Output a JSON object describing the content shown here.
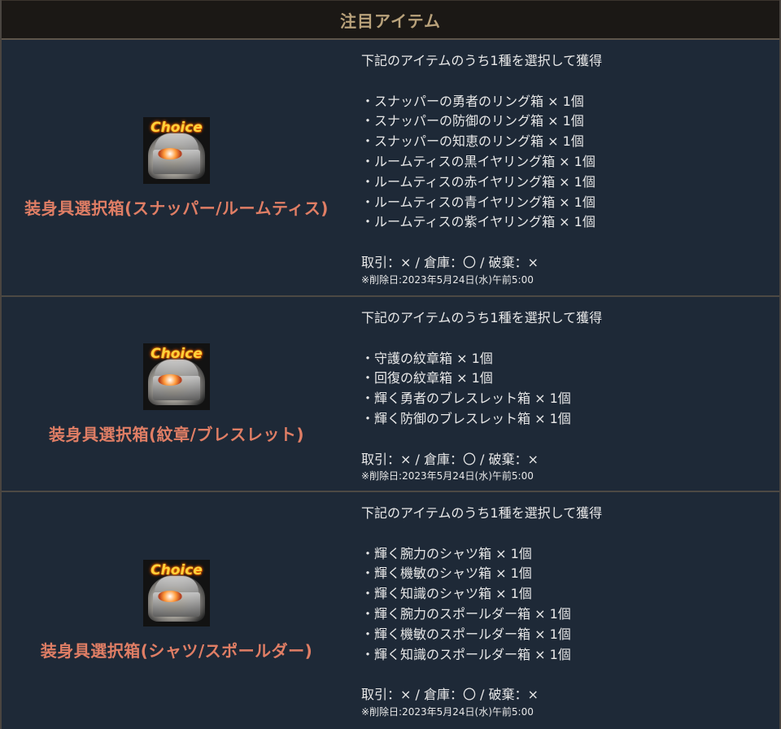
{
  "header": {
    "title": "注目アイテム"
  },
  "icon_label": "Choice",
  "items": [
    {
      "name": "装身具選択箱(スナッパー/ルームティス)",
      "intro": "下記のアイテムのうち1種を選択して獲得",
      "contents": [
        "・スナッパーの勇者のリング箱 × 1個",
        "・スナッパーの防御のリング箱 × 1個",
        "・スナッパーの知恵のリング箱 × 1個",
        "・ルームティスの黒イヤリング箱 × 1個",
        "・ルームティスの赤イヤリング箱 × 1個",
        "・ルームティスの青イヤリング箱 × 1個",
        "・ルームティスの紫イヤリング箱 × 1個"
      ],
      "trade": "取引：× / 倉庫：〇 / 破棄：×",
      "deletion": "※削除日:2023年5月24日(水)午前5:00"
    },
    {
      "name": "装身具選択箱(紋章/ブレスレット)",
      "intro": "下記のアイテムのうち1種を選択して獲得",
      "contents": [
        "・守護の紋章箱 × 1個",
        "・回復の紋章箱 × 1個",
        "・輝く勇者のブレスレット箱 × 1個",
        "・輝く防御のブレスレット箱 × 1個"
      ],
      "trade": "取引：× / 倉庫：〇 / 破棄：×",
      "deletion": "※削除日:2023年5月24日(水)午前5:00"
    },
    {
      "name": "装身具選択箱(シャツ/スポールダー)",
      "intro": "下記のアイテムのうち1種を選択して獲得",
      "contents": [
        "・輝く腕力のシャツ箱 × 1個",
        "・輝く機敏のシャツ箱 × 1個",
        "・輝く知識のシャツ箱 × 1個",
        "・輝く腕力のスポールダー箱 × 1個",
        "・輝く機敏のスポールダー箱 × 1個",
        "・輝く知識のスポールダー箱 × 1個"
      ],
      "trade": "取引：× / 倉庫：〇 / 破棄：×",
      "deletion": "※削除日:2023年5月24日(水)午前5:00"
    }
  ],
  "colors": {
    "header_text": "#b9a27b",
    "item_name": "#e07e65",
    "background": "#1e2937"
  }
}
